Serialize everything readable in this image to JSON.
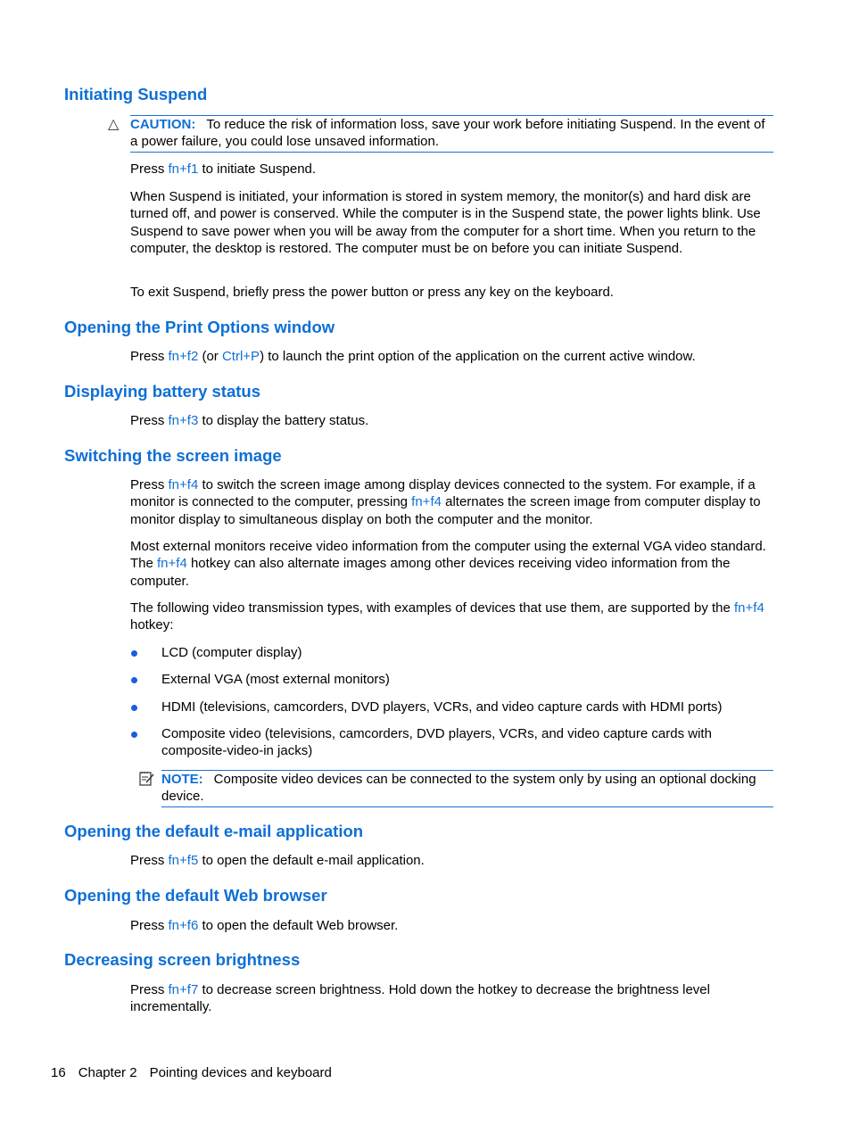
{
  "sections": {
    "suspend": {
      "heading": "Initiating Suspend",
      "caution": {
        "icon": "warning-triangle-icon",
        "label": "CAUTION:",
        "text": "To reduce the risk of information loss, save your work before initiating Suspend. In the event of a power failure, you could lose unsaved information."
      },
      "p1": {
        "pre": "Press ",
        "key": "fn+f1",
        "post": " to initiate Suspend."
      },
      "p2": "When Suspend is initiated, your information is stored in system memory, the monitor(s) and hard disk are turned off, and power is conserved. While the computer is in the Suspend state, the power lights blink. Use Suspend to save power when you will be away from the computer for a short time. When you return to the computer, the desktop is restored. The computer must be on before you can initiate Suspend.",
      "p3": "To exit Suspend, briefly press the power button or press any key on the keyboard."
    },
    "print": {
      "heading": "Opening the Print Options window",
      "p1": {
        "pre": "Press ",
        "key": "fn+f2",
        "mid": " (or ",
        "key2": "Ctrl+P",
        "post": ") to launch the print option of the application on the current active window."
      }
    },
    "battery": {
      "heading": "Displaying battery status",
      "p1": {
        "pre": "Press ",
        "key": "fn+f3",
        "post": " to display the battery status."
      }
    },
    "screen": {
      "heading": "Switching the screen image",
      "p1": {
        "pre": "Press ",
        "key": "fn+f4",
        "mid": " to switch the screen image among display devices connected to the system. For example, if a monitor is connected to the computer, pressing ",
        "key2": "fn+f4",
        "post": " alternates the screen image from computer display to monitor display to simultaneous display on both the computer and the monitor."
      },
      "p2": {
        "pre": "Most external monitors receive video information from the computer using the external VGA video standard. The ",
        "key": "fn+f4",
        "post": " hotkey can also alternate images among other devices receiving video information from the computer."
      },
      "p3": {
        "pre": "The following video transmission types, with examples of devices that use them, are supported by the ",
        "key": "fn+f4",
        "post": " hotkey:"
      },
      "bullets": [
        "LCD (computer display)",
        "External VGA (most external monitors)",
        "HDMI (televisions, camcorders, DVD players, VCRs, and video capture cards with HDMI ports)",
        "Composite video (televisions, camcorders, DVD players, VCRs, and video capture cards with composite-video-in jacks)"
      ],
      "note": {
        "icon": "note-pad-icon",
        "label": "NOTE:",
        "text": "Composite video devices can be connected to the system only by using an optional docking device."
      }
    },
    "email": {
      "heading": "Opening the default e-mail application",
      "p1": {
        "pre": "Press ",
        "key": "fn+f5",
        "post": " to open the default e-mail application."
      }
    },
    "web": {
      "heading": "Opening the default Web browser",
      "p1": {
        "pre": "Press ",
        "key": "fn+f6",
        "post": " to open the default Web browser."
      }
    },
    "brightness": {
      "heading": "Decreasing screen brightness",
      "p1": {
        "pre": "Press ",
        "key": "fn+f7",
        "post": " to decrease screen brightness. Hold down the hotkey to decrease the brightness level incrementally."
      }
    }
  },
  "footer": {
    "page_number": "16",
    "chapter": "Chapter 2",
    "chapter_title": "Pointing devices and keyboard"
  },
  "colors": {
    "heading": "#0f6fd6",
    "link": "#0f6fd6",
    "rule": "#1f6fd0",
    "bullet": "#1a5ee0"
  }
}
